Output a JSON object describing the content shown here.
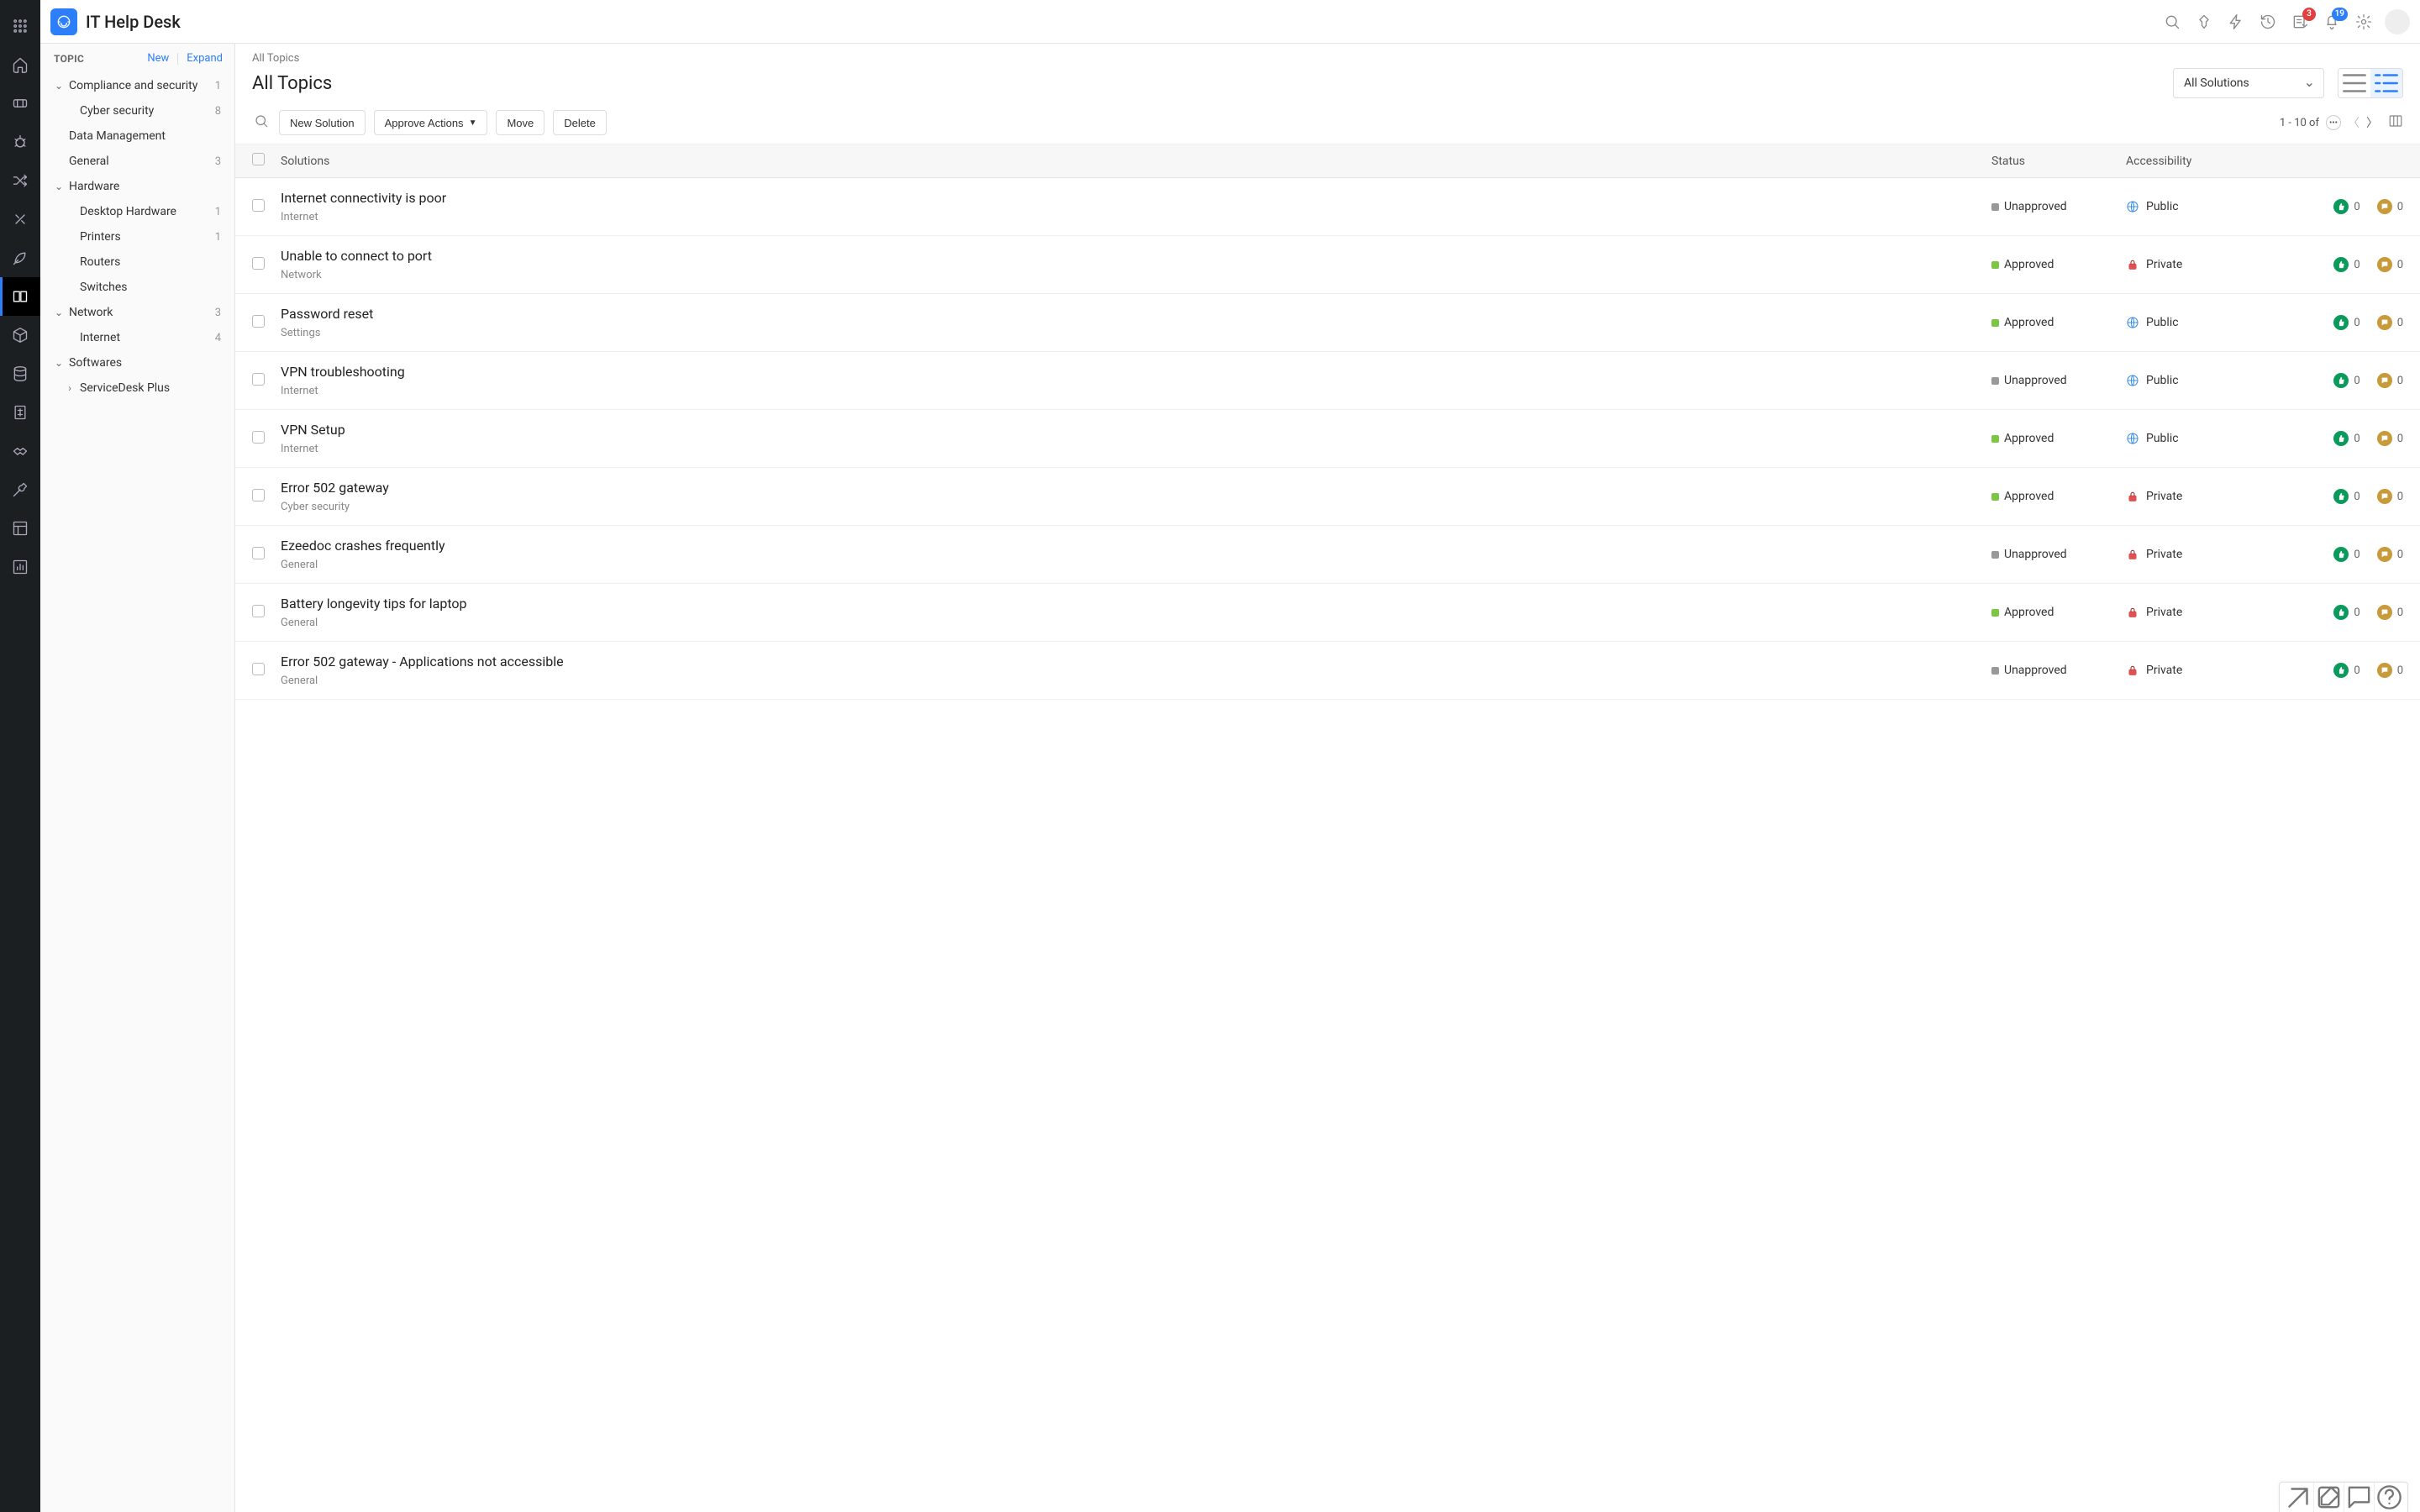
{
  "header": {
    "app_title": "IT Help Desk",
    "badges": {
      "approvals": "3",
      "notifications": "19"
    }
  },
  "sidebar": {
    "section_label": "TOPIC",
    "new_label": "New",
    "expand_label": "Expand",
    "items": [
      {
        "label": "Compliance and security",
        "count": "1",
        "expandable": true,
        "level": 0
      },
      {
        "label": "Cyber security",
        "count": "8",
        "level": 1
      },
      {
        "label": "Data Management",
        "count": "",
        "level": 0,
        "noarrow": true
      },
      {
        "label": "General",
        "count": "3",
        "level": 0,
        "noarrow": true
      },
      {
        "label": "Hardware",
        "count": "",
        "expandable": true,
        "level": 0
      },
      {
        "label": "Desktop Hardware",
        "count": "1",
        "level": 1
      },
      {
        "label": "Printers",
        "count": "1",
        "level": 1
      },
      {
        "label": "Routers",
        "count": "",
        "level": 1
      },
      {
        "label": "Switches",
        "count": "",
        "level": 1
      },
      {
        "label": "Network",
        "count": "3",
        "expandable": true,
        "level": 0
      },
      {
        "label": "Internet",
        "count": "4",
        "level": 1
      },
      {
        "label": "Softwares",
        "count": "",
        "expandable": true,
        "level": 0
      },
      {
        "label": "ServiceDesk Plus",
        "count": "",
        "level": 1,
        "subexpand": true
      }
    ]
  },
  "main": {
    "breadcrumb": "All Topics",
    "title": "All Topics",
    "filter_label": "All Solutions",
    "toolbar": {
      "new_solution": "New Solution",
      "approve_actions": "Approve Actions",
      "move": "Move",
      "delete": "Delete",
      "pager": "1 - 10 of"
    },
    "columns": {
      "solutions": "Solutions",
      "status": "Status",
      "accessibility": "Accessibility"
    },
    "rows": [
      {
        "title": "Internet connectivity is poor",
        "category": "Internet",
        "status": "Unapproved",
        "status_kind": "unapproved",
        "accessibility": "Public",
        "acc_kind": "public",
        "likes": "0",
        "comments": "0"
      },
      {
        "title": "Unable to connect to port",
        "category": "Network",
        "status": "Approved",
        "status_kind": "approved",
        "accessibility": "Private",
        "acc_kind": "private",
        "likes": "0",
        "comments": "0"
      },
      {
        "title": "Password reset",
        "category": "Settings",
        "status": "Approved",
        "status_kind": "approved",
        "accessibility": "Public",
        "acc_kind": "public",
        "likes": "0",
        "comments": "0"
      },
      {
        "title": "VPN troubleshooting",
        "category": "Internet",
        "status": "Unapproved",
        "status_kind": "unapproved",
        "accessibility": "Public",
        "acc_kind": "public",
        "likes": "0",
        "comments": "0"
      },
      {
        "title": "VPN Setup",
        "category": "Internet",
        "status": "Approved",
        "status_kind": "approved",
        "accessibility": "Public",
        "acc_kind": "public",
        "likes": "0",
        "comments": "0"
      },
      {
        "title": "Error 502 gateway",
        "category": "Cyber security",
        "status": "Approved",
        "status_kind": "approved",
        "accessibility": "Private",
        "acc_kind": "private",
        "likes": "0",
        "comments": "0"
      },
      {
        "title": "Ezeedoc crashes frequently",
        "category": "General",
        "status": "Unapproved",
        "status_kind": "unapproved",
        "accessibility": "Private",
        "acc_kind": "private",
        "likes": "0",
        "comments": "0"
      },
      {
        "title": "Battery longevity tips for laptop",
        "category": "General",
        "status": "Approved",
        "status_kind": "approved",
        "accessibility": "Private",
        "acc_kind": "private",
        "likes": "0",
        "comments": "0"
      },
      {
        "title": "Error 502 gateway - Applications not accessible",
        "category": "General",
        "status": "Unapproved",
        "status_kind": "unapproved",
        "accessibility": "Private",
        "acc_kind": "private",
        "likes": "0",
        "comments": "0"
      }
    ]
  }
}
